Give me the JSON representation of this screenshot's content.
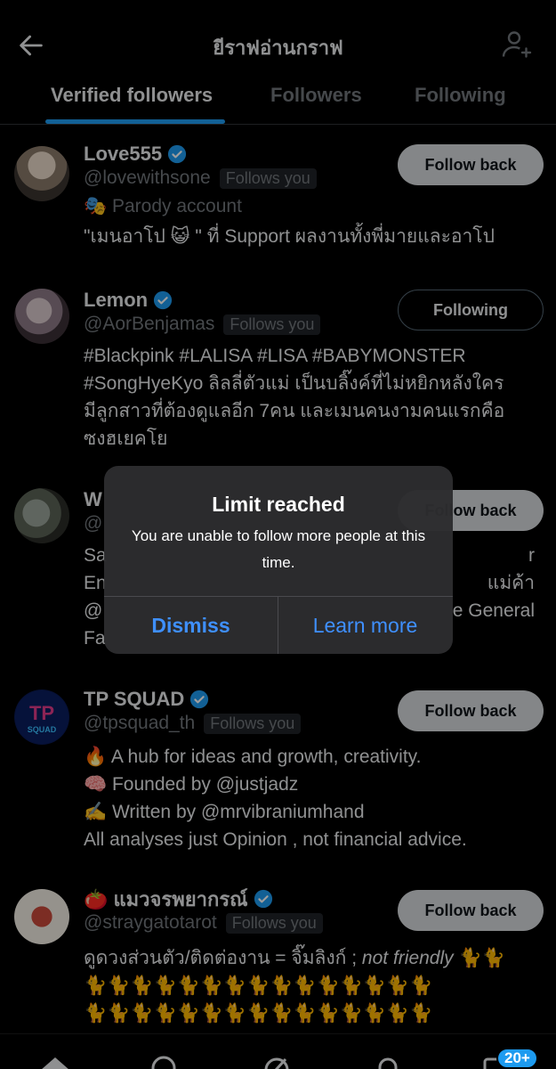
{
  "header": {
    "title": "ยีราฟอ่านกราฟ",
    "back_icon": "arrow-left-icon",
    "add_icon": "person-add-icon"
  },
  "tabs": [
    {
      "label": "Verified followers",
      "active": true
    },
    {
      "label": "Followers",
      "active": false
    },
    {
      "label": "Following",
      "active": false
    }
  ],
  "users": [
    {
      "name": "Love555",
      "handle": "@lovewithsone",
      "follows_you": "Follows you",
      "parody": "Parody account",
      "bio_lines": [
        "\"เมนอาโป 😺 \" ที่ Support ผลงานทั้งพี่มายและอาโป"
      ],
      "button": "Follow back"
    },
    {
      "name": "Lemon",
      "handle": "@AorBenjamas",
      "follows_you": "Follows you",
      "bio_lines": [
        "#Blackpink #LALISA #LISA #BABYMONSTER",
        "#SongHyeKyo ลิลลี่ตัวแม่ เป็นบลิ๊งค์ที่ไม่หยิกหลังใคร",
        "มีลูกสาวที่ต้องดูแลอีก 7คน และเมนคนงามคนแรกคือ",
        "ซงฮเยคโย"
      ],
      "button": "Following"
    },
    {
      "name": "W",
      "handle": "@",
      "bio_lines": [
        "Sa",
        "En",
        "@",
        "Fa"
      ],
      "bio_right_lines": [
        "r",
        "แม่ค้า",
        "e General",
        ""
      ],
      "button": "Follow back"
    },
    {
      "name": "TP SQUAD",
      "handle": "@tpsquad_th",
      "follows_you": "Follows you",
      "bio_lines": [
        "🔥 A hub for ideas and growth, creativity.",
        "🧠 Founded by @justjadz",
        "✍️ Written by @mrvibraniumhand",
        "All analyses just Opinion , not financial advice."
      ],
      "button": "Follow back"
    },
    {
      "name": "🍅 แมวจรพยากรณ์",
      "handle": "@straygatotarot",
      "follows_you": "Follows you",
      "bio_lines": [
        "ดูดวงส่วนตัว/ติดต่องาน = จิ๊มลิงก์ ;",
        "🐈🐈🐈🐈🐈🐈🐈🐈🐈🐈🐈🐈🐈🐈🐈",
        "🐈🐈🐈🐈🐈🐈🐈🐈🐈🐈🐈🐈🐈🐈🐈"
      ],
      "bio_italic": "not friendly",
      "bio_tail": "🐈🐈",
      "button": "Follow back"
    }
  ],
  "dialog": {
    "title": "Limit reached",
    "message": "You are unable to follow more people at this time.",
    "dismiss": "Dismiss",
    "learn_more": "Learn more"
  },
  "bottom_nav": {
    "icons": [
      "home-icon",
      "search-icon",
      "grok-icon",
      "notifications-icon",
      "messages-icon"
    ],
    "badge": "20+"
  },
  "colors": {
    "accent": "#1d9bf0",
    "dialog_button": "#3f90ff",
    "muted": "#71767b"
  }
}
